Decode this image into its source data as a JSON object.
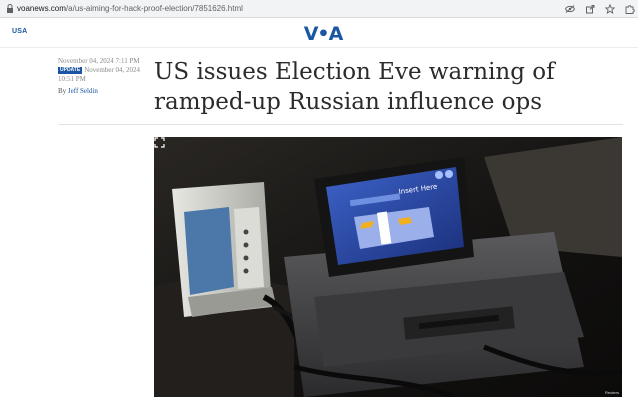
{
  "browser": {
    "url_host": "voanews.com",
    "url_path": "/a/us-aiming-for-hack-proof-election/7851626.html",
    "icons": [
      "eye-off-icon",
      "share-icon",
      "star-icon",
      "extension-icon"
    ]
  },
  "header": {
    "section": "USA",
    "logo": "VOA"
  },
  "article": {
    "published": "November 04, 2024 7:11 PM",
    "update_badge": "UPDATE",
    "updated": "November 04, 2024 10:51 PM",
    "by_prefix": "By",
    "author": "Jeff Seldin",
    "headline": "US issues Election Eve warning of ramped-up Russian influence ops"
  },
  "photo": {
    "screen_text": "Insert Here",
    "credit": "Reuters"
  },
  "colors": {
    "brand_blue": "#1a56a3",
    "headline": "#2b2b2b",
    "meta_gray": "#8a8a8a"
  }
}
